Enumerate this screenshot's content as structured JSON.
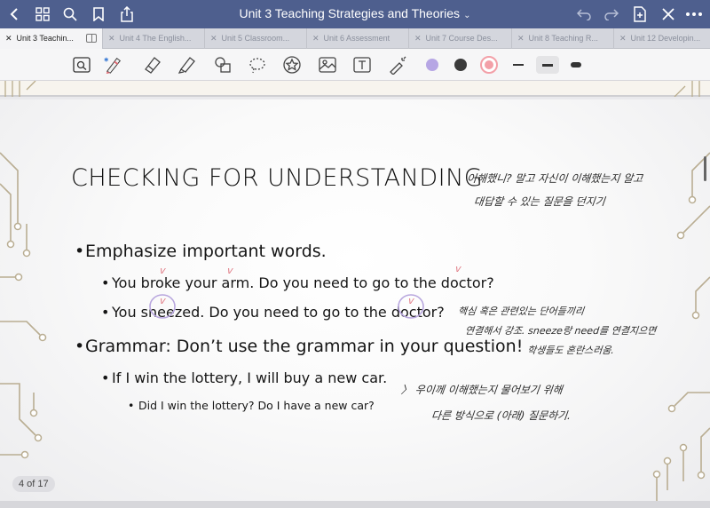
{
  "titlebar": {
    "title": "Unit 3 Teaching Strategies and Theories",
    "title_chevron": "⌄"
  },
  "tabs": [
    {
      "label": "Unit 3 Teachin...",
      "active": true
    },
    {
      "label": "Unit 4 The English...",
      "active": false
    },
    {
      "label": "Unit 5 Classroom...",
      "active": false
    },
    {
      "label": "Unit 6 Assessment",
      "active": false
    },
    {
      "label": "Unit 7 Course Des...",
      "active": false
    },
    {
      "label": "Unit 8 Teaching R...",
      "active": false
    },
    {
      "label": "Unit 12 Developin...",
      "active": false
    }
  ],
  "toolbar": {
    "colors": {
      "purple": "#b6a6e4",
      "dark": "#3a3a3a",
      "pink": "#f3a0a8"
    },
    "selected_color": "pink",
    "selected_thickness": "medium"
  },
  "slide": {
    "title": "CHECKING FOR UNDERSTANDING",
    "b1": "Emphasize important words.",
    "b1a": "You broke your arm. Do you need to go to the doctor?",
    "b1b": "You sneezed. Do you need to go to the doctor?",
    "b2": "Grammar: Don’t use the grammar in your question!",
    "b2a": "If I win the lottery, I will buy a new car.",
    "b2a1": "Did I win the lottery? Do I have a new car?",
    "bullet": "•"
  },
  "notes": {
    "n1": "이해했니? 말고  자신이 이해했는지 알고",
    "n2": "대답할 수 있는 질문을 던지기",
    "n3": "핵심 혹은 관련있는 단어들끼리",
    "n4": "연결해서 강조. sneeze랑 need를 연결지으면",
    "n5": "학생들도 혼란스러움.",
    "n6": "〉 우이께 이해했는지 물어보기 위해",
    "n7": "다른 방식으로 (아래) 질문하기."
  },
  "marks": {
    "check": "v"
  },
  "page_counter": "4 of 17"
}
